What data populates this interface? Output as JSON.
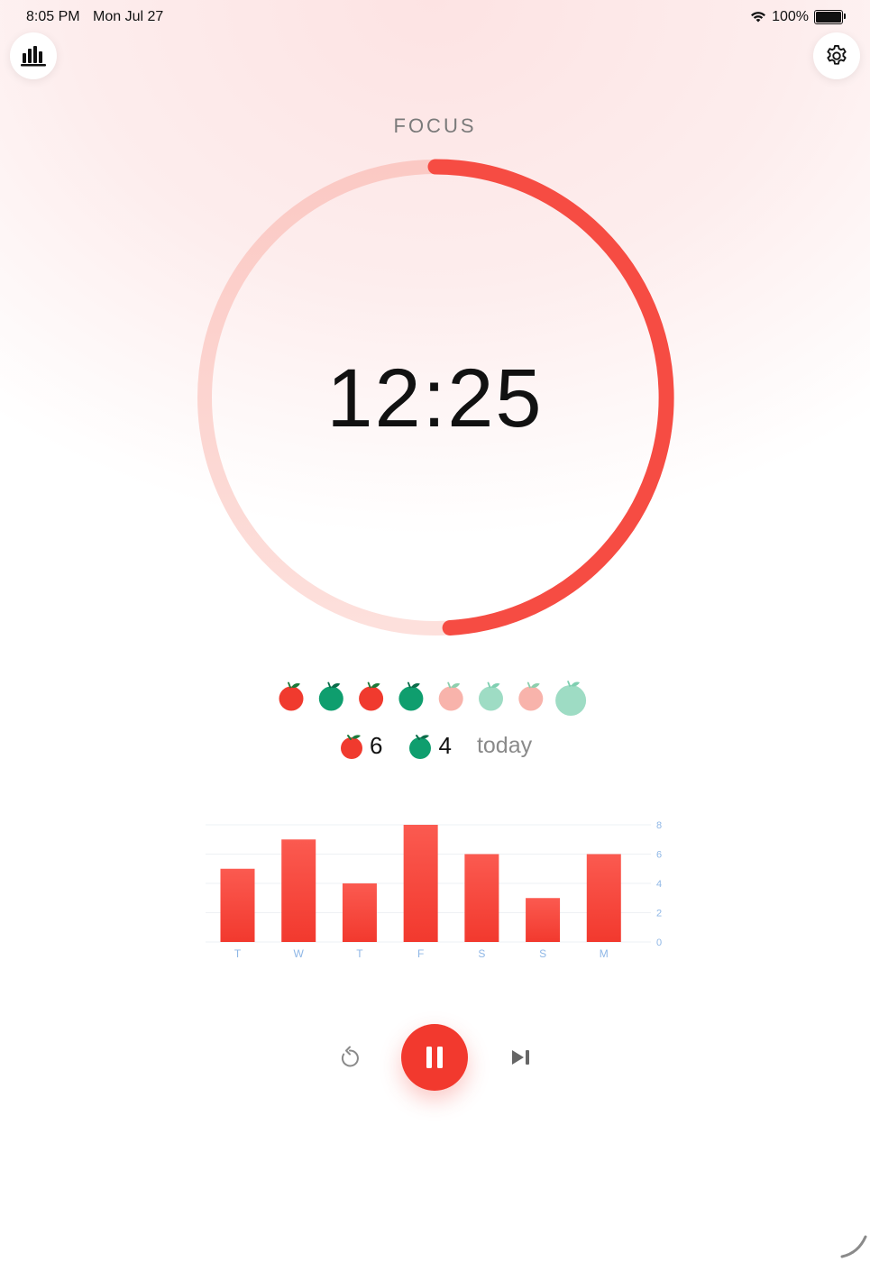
{
  "status_bar": {
    "time": "8:05 PM",
    "date": "Mon Jul 27",
    "battery": "100%",
    "wifi_icon": "wifi-icon",
    "battery_icon": "battery-icon"
  },
  "header": {
    "stats_icon": "bar-chart-icon",
    "settings_icon": "gear-icon"
  },
  "timer": {
    "mode": "FOCUS",
    "time": "12:25",
    "progress": 0.49
  },
  "sessions": {
    "icons": [
      {
        "type": "focus",
        "state": "done"
      },
      {
        "type": "break",
        "state": "done"
      },
      {
        "type": "focus",
        "state": "done"
      },
      {
        "type": "break",
        "state": "done"
      },
      {
        "type": "focus",
        "state": "pending"
      },
      {
        "type": "break",
        "state": "pending"
      },
      {
        "type": "focus",
        "state": "pending"
      },
      {
        "type": "long-break",
        "state": "pending"
      }
    ]
  },
  "today": {
    "focus_count": "6",
    "break_count": "4",
    "label": "today"
  },
  "chart_data": {
    "type": "bar",
    "categories": [
      "T",
      "W",
      "T",
      "F",
      "S",
      "S",
      "M"
    ],
    "values": [
      5,
      7,
      4,
      8,
      6,
      3,
      6
    ],
    "y_ticks": [
      "8",
      "6",
      "4",
      "2",
      "0"
    ],
    "ylim": [
      0,
      8
    ],
    "grid": true,
    "axis_position": "right"
  },
  "controls": {
    "reset_icon": "reset-icon",
    "pause_icon": "pause-icon",
    "skip_icon": "skip-forward-icon"
  },
  "colors": {
    "accent": "#f2392e",
    "ring_track": "#fcd7d3",
    "tomato_red": "#f03a2e",
    "tomato_green": "#0f9e6e",
    "axis_text": "#8fb7e6"
  }
}
